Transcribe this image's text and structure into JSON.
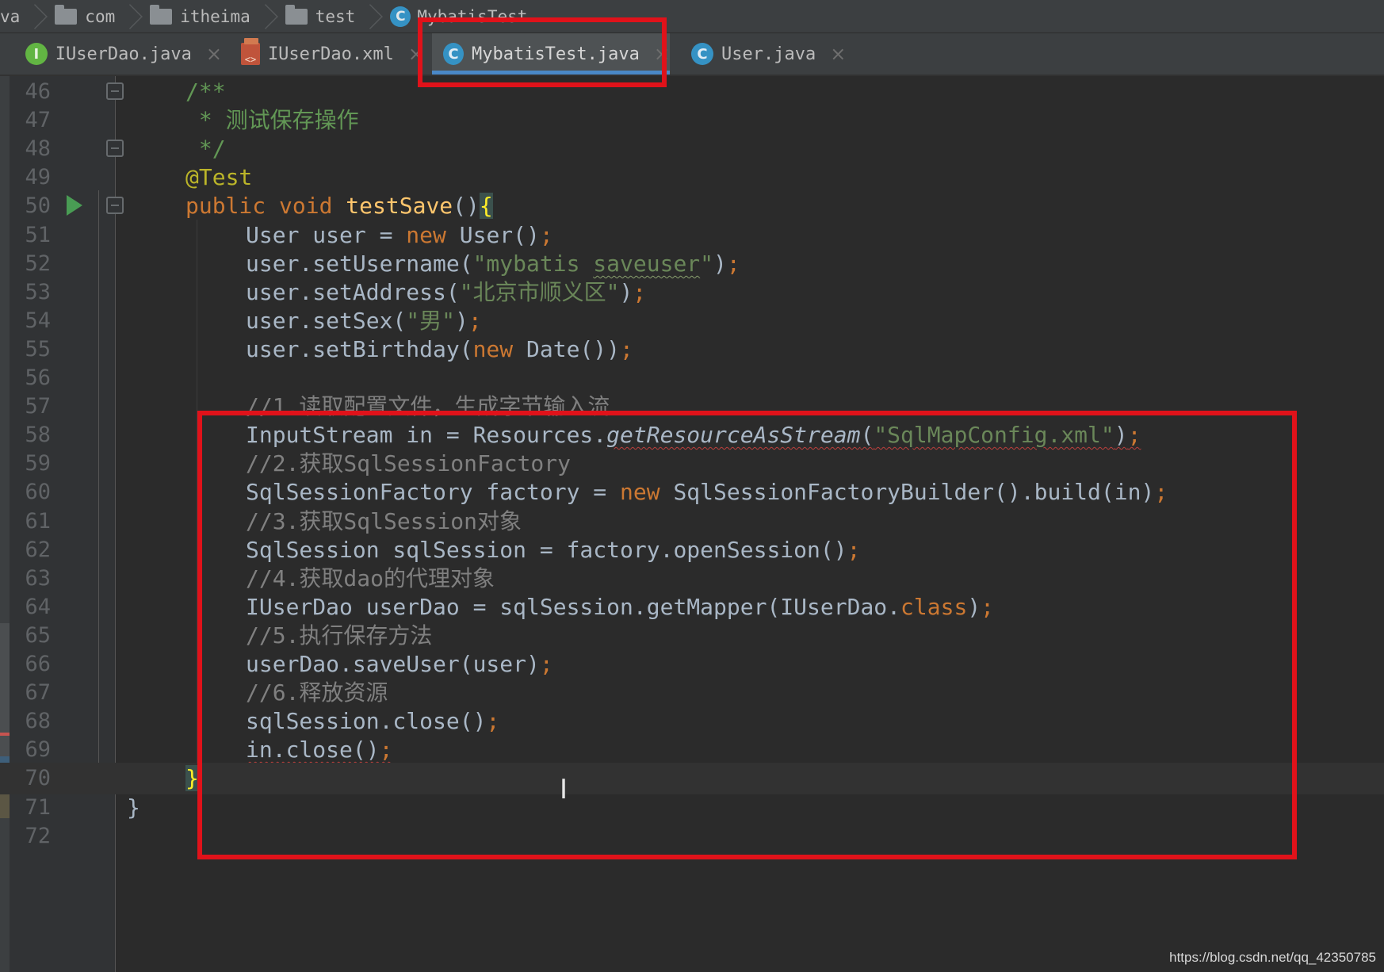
{
  "breadcrumb": [
    {
      "label": "va",
      "icon": null
    },
    {
      "label": "com",
      "icon": "folder-icon"
    },
    {
      "label": "itheima",
      "icon": "folder-icon"
    },
    {
      "label": "test",
      "icon": "folder-icon"
    },
    {
      "label": "MybatisTest",
      "icon": "class-icon"
    }
  ],
  "tabs": [
    {
      "label": "IUserDao.java",
      "icon": "interface-icon",
      "active": false
    },
    {
      "label": "IUserDao.xml",
      "icon": "xml-file-icon",
      "active": false
    },
    {
      "label": "MybatisTest.java",
      "icon": "class-icon",
      "active": true
    },
    {
      "label": "User.java",
      "icon": "class-icon",
      "active": false
    }
  ],
  "icon_letters": {
    "interface": "I",
    "class": "C",
    "xml": "<>"
  },
  "close_glyph": "×",
  "lines": [
    {
      "n": "46",
      "tokens": [
        [
          "comdoc",
          "/**"
        ]
      ]
    },
    {
      "n": "47",
      "tokens": [
        [
          "comdoc",
          " * 测试保存操作"
        ]
      ]
    },
    {
      "n": "48",
      "tokens": [
        [
          "comdoc",
          " */"
        ]
      ]
    },
    {
      "n": "49",
      "tokens": [
        [
          "ann",
          "@Test"
        ]
      ]
    },
    {
      "n": "50",
      "tokens": [
        [
          "kw",
          "public void "
        ],
        [
          "fn",
          "testSave"
        ],
        [
          "",
          "()"
        ],
        [
          "brace-match",
          "{"
        ]
      ]
    },
    {
      "n": "51",
      "tokens": [
        [
          "",
          "    User user = "
        ],
        [
          "kw",
          "new "
        ],
        [
          "",
          "User()"
        ],
        [
          "kw",
          ";"
        ]
      ]
    },
    {
      "n": "52",
      "tokens": [
        [
          "",
          "    user.setUsername("
        ],
        [
          "str",
          "\"mybatis "
        ],
        [
          "str sqg",
          "saveuser"
        ],
        [
          "str",
          "\""
        ],
        [
          "",
          ")"
        ],
        [
          "kw",
          ";"
        ]
      ]
    },
    {
      "n": "53",
      "tokens": [
        [
          "",
          "    user.setAddress("
        ],
        [
          "str",
          "\"北京市顺义区\""
        ],
        [
          "",
          ")"
        ],
        [
          "kw",
          ";"
        ]
      ]
    },
    {
      "n": "54",
      "tokens": [
        [
          "",
          "    user.setSex("
        ],
        [
          "str",
          "\"男\""
        ],
        [
          "",
          ")"
        ],
        [
          "kw",
          ";"
        ]
      ]
    },
    {
      "n": "55",
      "tokens": [
        [
          "",
          "    user.setBirthday("
        ],
        [
          "kw",
          "new "
        ],
        [
          "",
          "Date())"
        ],
        [
          "kw",
          ";"
        ]
      ]
    },
    {
      "n": "56",
      "tokens": []
    },
    {
      "n": "57",
      "tokens": [
        [
          "com",
          "    //1.读取配置文件，生成字节输入流"
        ]
      ]
    },
    {
      "n": "58",
      "tokens": [
        [
          "",
          "    InputStream in = Resources."
        ],
        [
          "ital sq",
          "getResourceAsStream"
        ],
        [
          "sq",
          "("
        ],
        [
          "str sq",
          "\"SqlMapConfig.xml\""
        ],
        [
          "sq",
          ")"
        ],
        [
          "kw sq",
          ";"
        ]
      ]
    },
    {
      "n": "59",
      "tokens": [
        [
          "com",
          "    //2.获取SqlSessionFactory"
        ]
      ]
    },
    {
      "n": "60",
      "tokens": [
        [
          "",
          "    SqlSessionFactory factory = "
        ],
        [
          "kw",
          "new "
        ],
        [
          "",
          "SqlSessionFactoryBuilder().build(in)"
        ],
        [
          "kw",
          ";"
        ]
      ]
    },
    {
      "n": "61",
      "tokens": [
        [
          "com",
          "    //3.获取SqlSession对象"
        ]
      ]
    },
    {
      "n": "62",
      "tokens": [
        [
          "",
          "    SqlSession sqlSession = factory.openSession()"
        ],
        [
          "kw",
          ";"
        ]
      ]
    },
    {
      "n": "63",
      "tokens": [
        [
          "com",
          "    //4.获取dao的代理对象"
        ]
      ]
    },
    {
      "n": "64",
      "tokens": [
        [
          "",
          "    IUserDao userDao = sqlSession.getMapper(IUserDao."
        ],
        [
          "kw",
          "class"
        ],
        [
          "",
          ")"
        ],
        [
          "kw",
          ";"
        ]
      ]
    },
    {
      "n": "65",
      "tokens": [
        [
          "com",
          "    //5.执行保存方法"
        ]
      ]
    },
    {
      "n": "66",
      "tokens": [
        [
          "",
          "    userDao.saveUser(user)"
        ],
        [
          "kw",
          ";"
        ]
      ]
    },
    {
      "n": "67",
      "tokens": [
        [
          "com",
          "    //6.释放资源"
        ]
      ]
    },
    {
      "n": "68",
      "tokens": [
        [
          "",
          "    sqlSession.close()"
        ],
        [
          "kw",
          ";"
        ]
      ]
    },
    {
      "n": "69",
      "tokens": [
        [
          "",
          "    "
        ],
        [
          "sq",
          "in.close()"
        ],
        [
          "kw sq",
          ";"
        ]
      ]
    },
    {
      "n": "70",
      "tokens": [
        [
          "brace-match",
          "}"
        ]
      ]
    },
    {
      "n": "71",
      "tokens": [
        [
          "",
          "}"
        ]
      ]
    },
    {
      "n": "72",
      "tokens": []
    }
  ],
  "watermark": "https://blog.csdn.net/qq_42350785",
  "colors": {
    "keyword": "#cc7832",
    "string": "#6a8759",
    "comment": "#808080",
    "annotation": "#bbb529",
    "method": "#ffc66d",
    "highlight_box": "#e0121a",
    "active_tab_underline": "#4a88c7"
  }
}
